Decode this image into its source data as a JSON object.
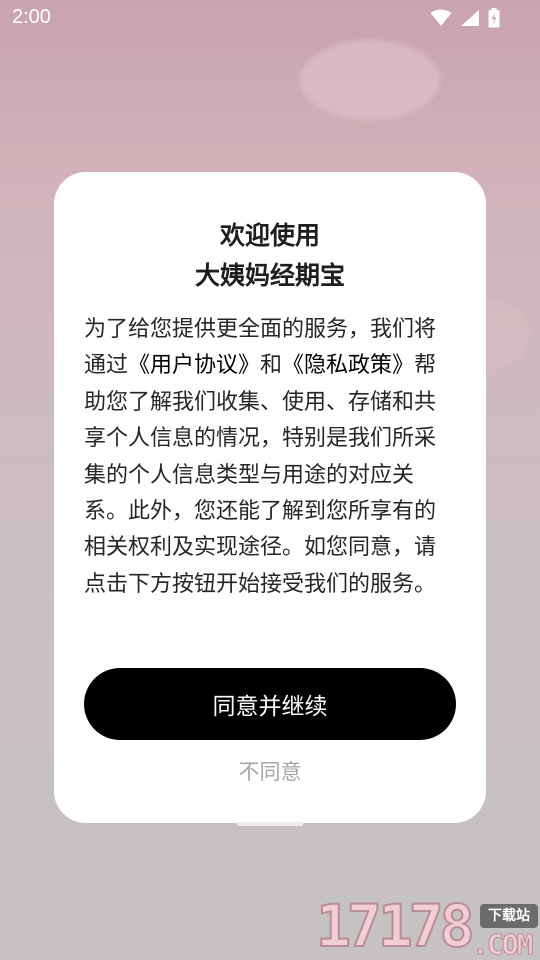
{
  "status_bar": {
    "time": "2:00",
    "icons": [
      "wifi-icon",
      "signal-icon",
      "battery-charging-icon"
    ]
  },
  "dialog": {
    "title_line1": "欢迎使用",
    "title_line2": "大姨妈经期宝",
    "body": {
      "intro": "为了给您提供更全面的服务，我们将通过",
      "user_agreement": "《用户协议》",
      "conj": "和",
      "privacy_policy": "《隐私政策》",
      "rest": "帮助您了解我们收集、使用、存储和共享个人信息的情况，特别是我们所采集的个人信息类型与用途的对应关系。此外，您还能了解到您所享有的相关权利及实现途径。如您同意，请点击下方按钮开始接受我们的服务。"
    },
    "agree_button": "同意并继续",
    "disagree_button": "不同意"
  },
  "watermark": {
    "number": "17178",
    "badge": "下载站",
    "domain": ".COM"
  },
  "colors": {
    "background_top": "#c9a3ae",
    "background_bottom": "#c6c1c3",
    "dialog_bg": "#ffffff",
    "primary_button": "#000000",
    "disagree_text": "#a6a6a6"
  }
}
